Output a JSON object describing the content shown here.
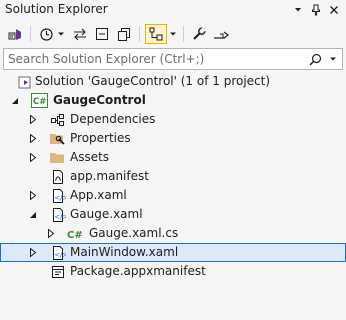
{
  "window": {
    "title": "Solution Explorer",
    "dropdown_icon": "chevron-down-icon",
    "pin_icon": "pin-icon",
    "close_icon": "close-icon"
  },
  "toolbar": {
    "icons": [
      "vs-switch-views-icon",
      "history-icon",
      "chevron-down-icon",
      "sync-arrows-icon",
      "collapse-all-icon",
      "show-all-files-icon",
      "filter-pending-icon",
      "chevron-down-icon",
      "wrench-properties-icon",
      "preview-icon"
    ]
  },
  "search": {
    "placeholder": "Search Solution Explorer (Ctrl+;)",
    "value": "",
    "search_icon": "search-icon",
    "options_icon": "chevron-down-icon"
  },
  "tree": {
    "items": [
      {
        "label": "Solution 'GaugeControl' (1 of 1 project)",
        "icon": "solution-icon",
        "expander": "none",
        "bold": false,
        "selected": false
      },
      {
        "label": "GaugeControl",
        "icon": "csharp-project-icon",
        "expander": "expanded",
        "bold": true,
        "selected": false
      },
      {
        "label": "Dependencies",
        "icon": "dependencies-icon",
        "expander": "collapsed",
        "bold": false,
        "selected": false
      },
      {
        "label": "Properties",
        "icon": "properties-folder-icon",
        "expander": "collapsed",
        "bold": false,
        "selected": false
      },
      {
        "label": "Assets",
        "icon": "folder-icon",
        "expander": "collapsed",
        "bold": false,
        "selected": false
      },
      {
        "label": "app.manifest",
        "icon": "manifest-file-icon",
        "expander": "none",
        "bold": false,
        "selected": false
      },
      {
        "label": "App.xaml",
        "icon": "xaml-file-icon",
        "expander": "collapsed",
        "bold": false,
        "selected": false
      },
      {
        "label": "Gauge.xaml",
        "icon": "xaml-file-icon",
        "expander": "expanded",
        "bold": false,
        "selected": false
      },
      {
        "label": "Gauge.xaml.cs",
        "icon": "csharp-file-icon",
        "expander": "collapsed",
        "bold": false,
        "selected": false
      },
      {
        "label": "MainWindow.xaml",
        "icon": "xaml-file-icon",
        "expander": "collapsed",
        "bold": false,
        "selected": true
      },
      {
        "label": "Package.appxmanifest",
        "icon": "appx-manifest-icon",
        "expander": "none",
        "bold": false,
        "selected": false
      }
    ]
  },
  "colors": {
    "background": "#f5f5f5",
    "selection_fill": "#dde8f8",
    "selection_border": "#1e6fd3",
    "csharp_green": "#388a34",
    "folder_yellow": "#dcb67a",
    "xaml_blue": "#1e6fd3",
    "active_toggle": "#fff4cc"
  }
}
